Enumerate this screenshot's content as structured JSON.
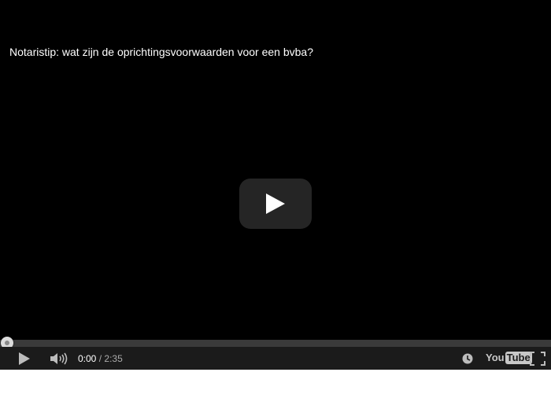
{
  "video": {
    "title": "Notaristip: wat zijn de oprichtingsvoorwaarden voor een bvba?"
  },
  "controls": {
    "current_time": "0:00",
    "separator": "/",
    "duration": "2:35",
    "progress_fraction": 0,
    "icons": {
      "big_play": "play-icon",
      "play": "play-icon",
      "volume": "volume-icon",
      "watch_later": "clock-icon",
      "logo": "youtube-logo",
      "fullscreen": "fullscreen-icon"
    }
  },
  "logo": {
    "part1": "You",
    "part2": "Tube"
  },
  "colors": {
    "player_bg": "#000000",
    "controlbar_bg": "#1b1b1b",
    "progress_track": "#3a3a3a",
    "progress_fill": "#cc181e"
  }
}
